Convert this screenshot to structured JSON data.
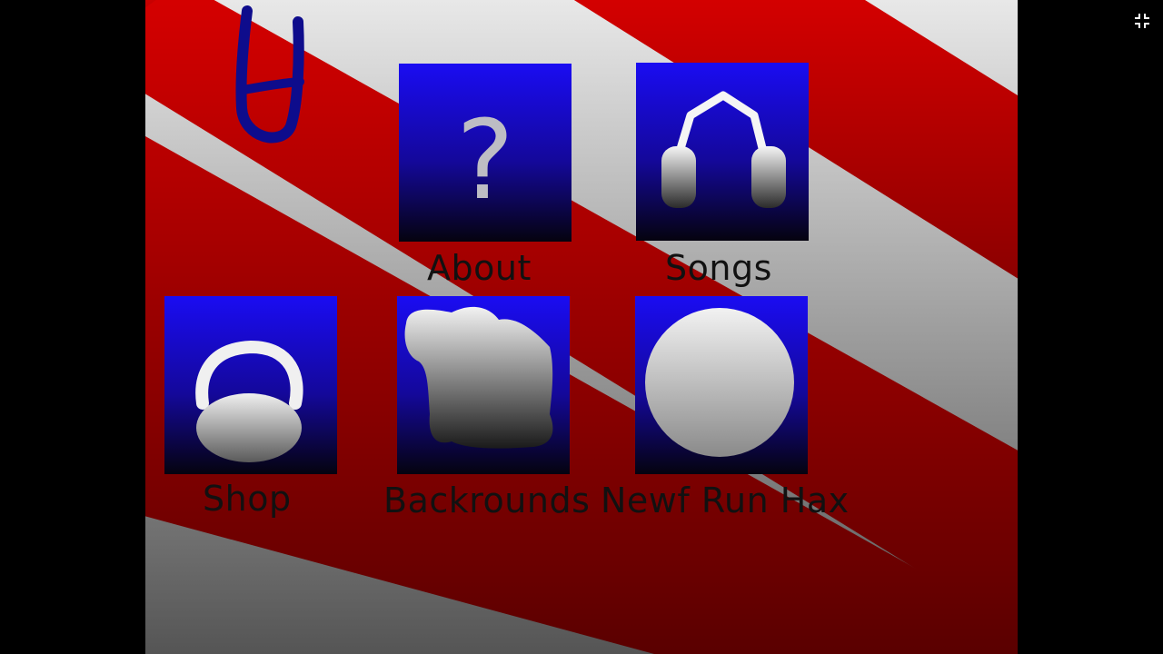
{
  "menu": {
    "items": [
      {
        "id": "about",
        "label": "About",
        "icon": "question-mark-icon"
      },
      {
        "id": "songs",
        "label": "Songs",
        "icon": "headphones-icon"
      },
      {
        "id": "shop",
        "label": "Shop",
        "icon": "shopping-basket-icon"
      },
      {
        "id": "backgrounds",
        "label": "Backrounds",
        "icon": "background-blob-icon"
      },
      {
        "id": "hax",
        "label": "Newf Run Hax",
        "icon": "circle-icon"
      }
    ]
  },
  "logo": {
    "icon": "logo-icon"
  },
  "controls": {
    "exit_fullscreen_icon": "exit-fullscreen-icon"
  },
  "theme": {
    "stripe_red": "#d40000",
    "stripe_white": "#e6e6e6",
    "tile_blue": "#1a0cf2",
    "letterbox": "#000000",
    "label_color": "#111111",
    "icon_color": "#f2f2f2"
  },
  "about_glyph": "?"
}
